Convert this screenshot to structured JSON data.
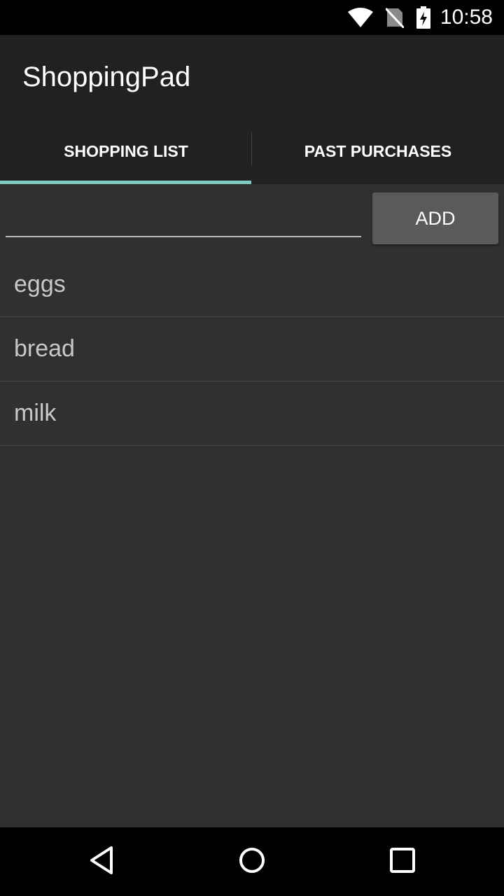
{
  "status_bar": {
    "time": "10:58",
    "icons": [
      "wifi-icon",
      "no-sim-icon",
      "battery-charging-icon"
    ]
  },
  "action_bar": {
    "title": "ShoppingPad"
  },
  "tabs": [
    {
      "label": "SHOPPING LIST",
      "selected": true
    },
    {
      "label": "PAST PURCHASES",
      "selected": false
    }
  ],
  "input": {
    "value": "",
    "placeholder": ""
  },
  "add_button": {
    "label": "ADD"
  },
  "items": [
    {
      "label": "eggs"
    },
    {
      "label": "bread"
    },
    {
      "label": "milk"
    }
  ],
  "nav_bar": {
    "icons": [
      "back-icon",
      "home-icon",
      "recents-icon"
    ]
  },
  "colors": {
    "background": "#303030",
    "action_bar": "#212121",
    "tab_indicator": "#80cbc4",
    "button": "#5a5a5a"
  }
}
